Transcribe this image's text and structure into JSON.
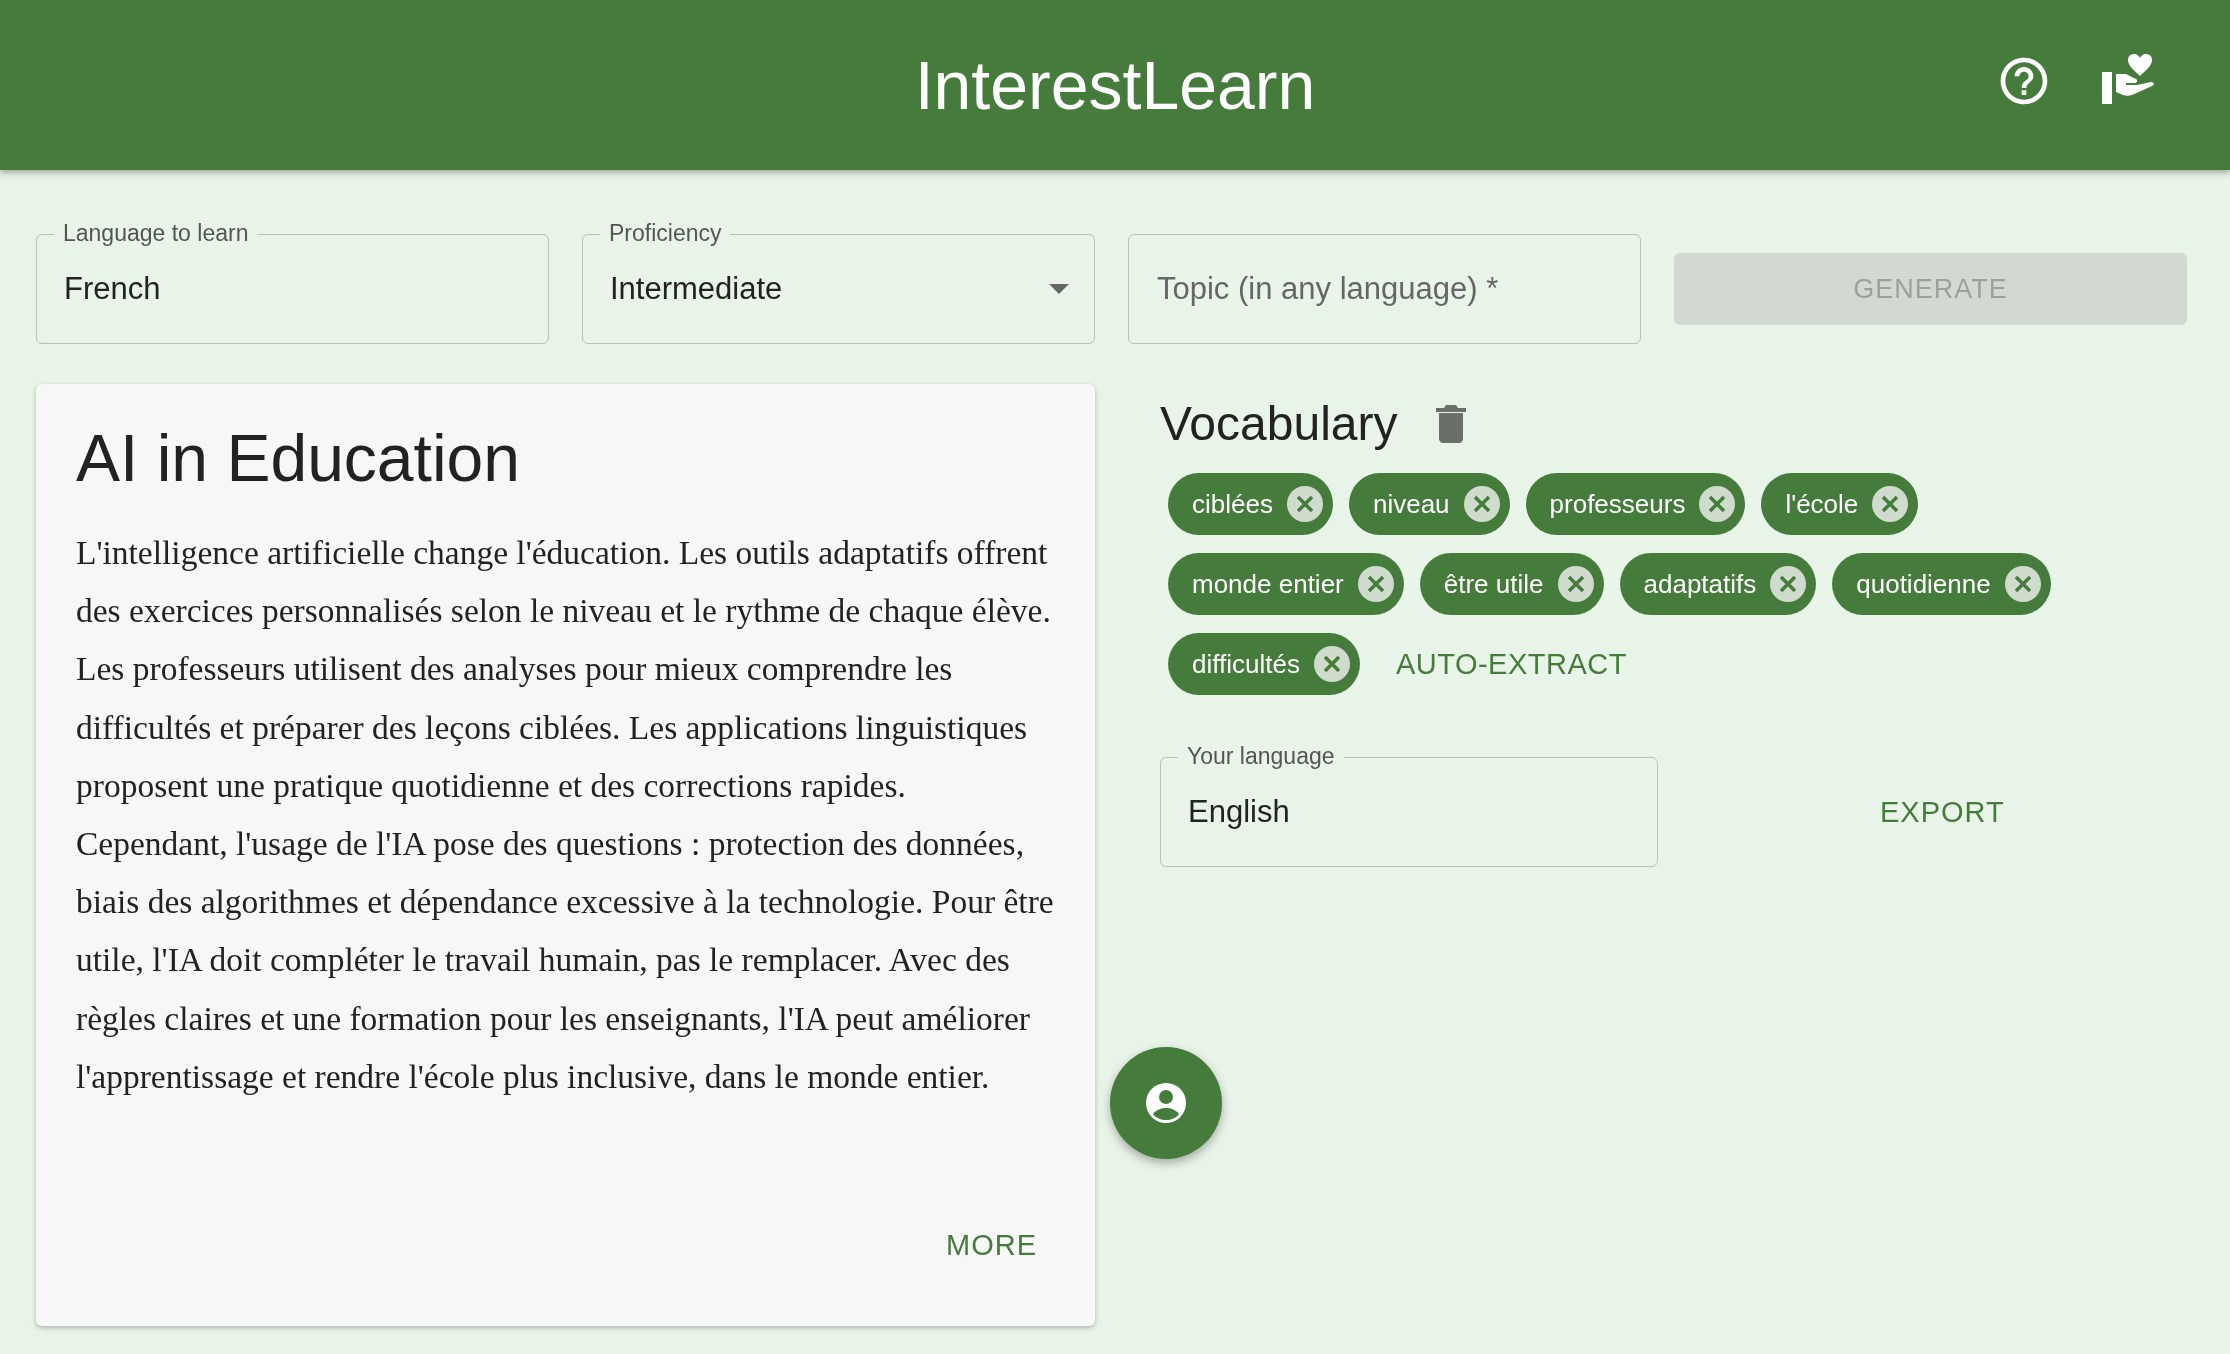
{
  "header": {
    "title": "InterestLearn"
  },
  "form": {
    "language": {
      "label": "Language to learn",
      "value": "French"
    },
    "proficiency": {
      "label": "Proficiency",
      "value": "Intermediate"
    },
    "topic": {
      "placeholder": "Topic (in any language) *"
    },
    "generate": {
      "label": "GENERATE",
      "disabled": true
    }
  },
  "article": {
    "title": "AI in Education",
    "body": "L'intelligence artificielle change l'éducation. Les outils adaptatifs offrent des exercices personnalisés selon le niveau et le rythme de chaque élève. Les professeurs utilisent des analyses pour mieux comprendre les difficultés et préparer des leçons ciblées. Les applications linguistiques proposent une pratique quotidienne et des corrections rapides. Cependant, l'usage de l'IA pose des questions : protection des données, biais des algorithmes et dépendance excessive à la technologie. Pour être utile, l'IA doit compléter le travail humain, pas le remplacer. Avec des règles claires et une formation pour les enseignants, l'IA peut améliorer l'apprentissage et rendre l'école plus inclusive, dans le monde entier.",
    "more": "MORE"
  },
  "vocabulary": {
    "title": "Vocabulary",
    "words": [
      "ciblées",
      "niveau",
      "professeurs",
      "l'école",
      "monde entier",
      "être utile",
      "adaptatifs",
      "quotidienne",
      "difficultés"
    ],
    "auto_extract": "AUTO-EXTRACT",
    "your_language": {
      "label": "Your language",
      "value": "English"
    },
    "export": "EXPORT"
  }
}
